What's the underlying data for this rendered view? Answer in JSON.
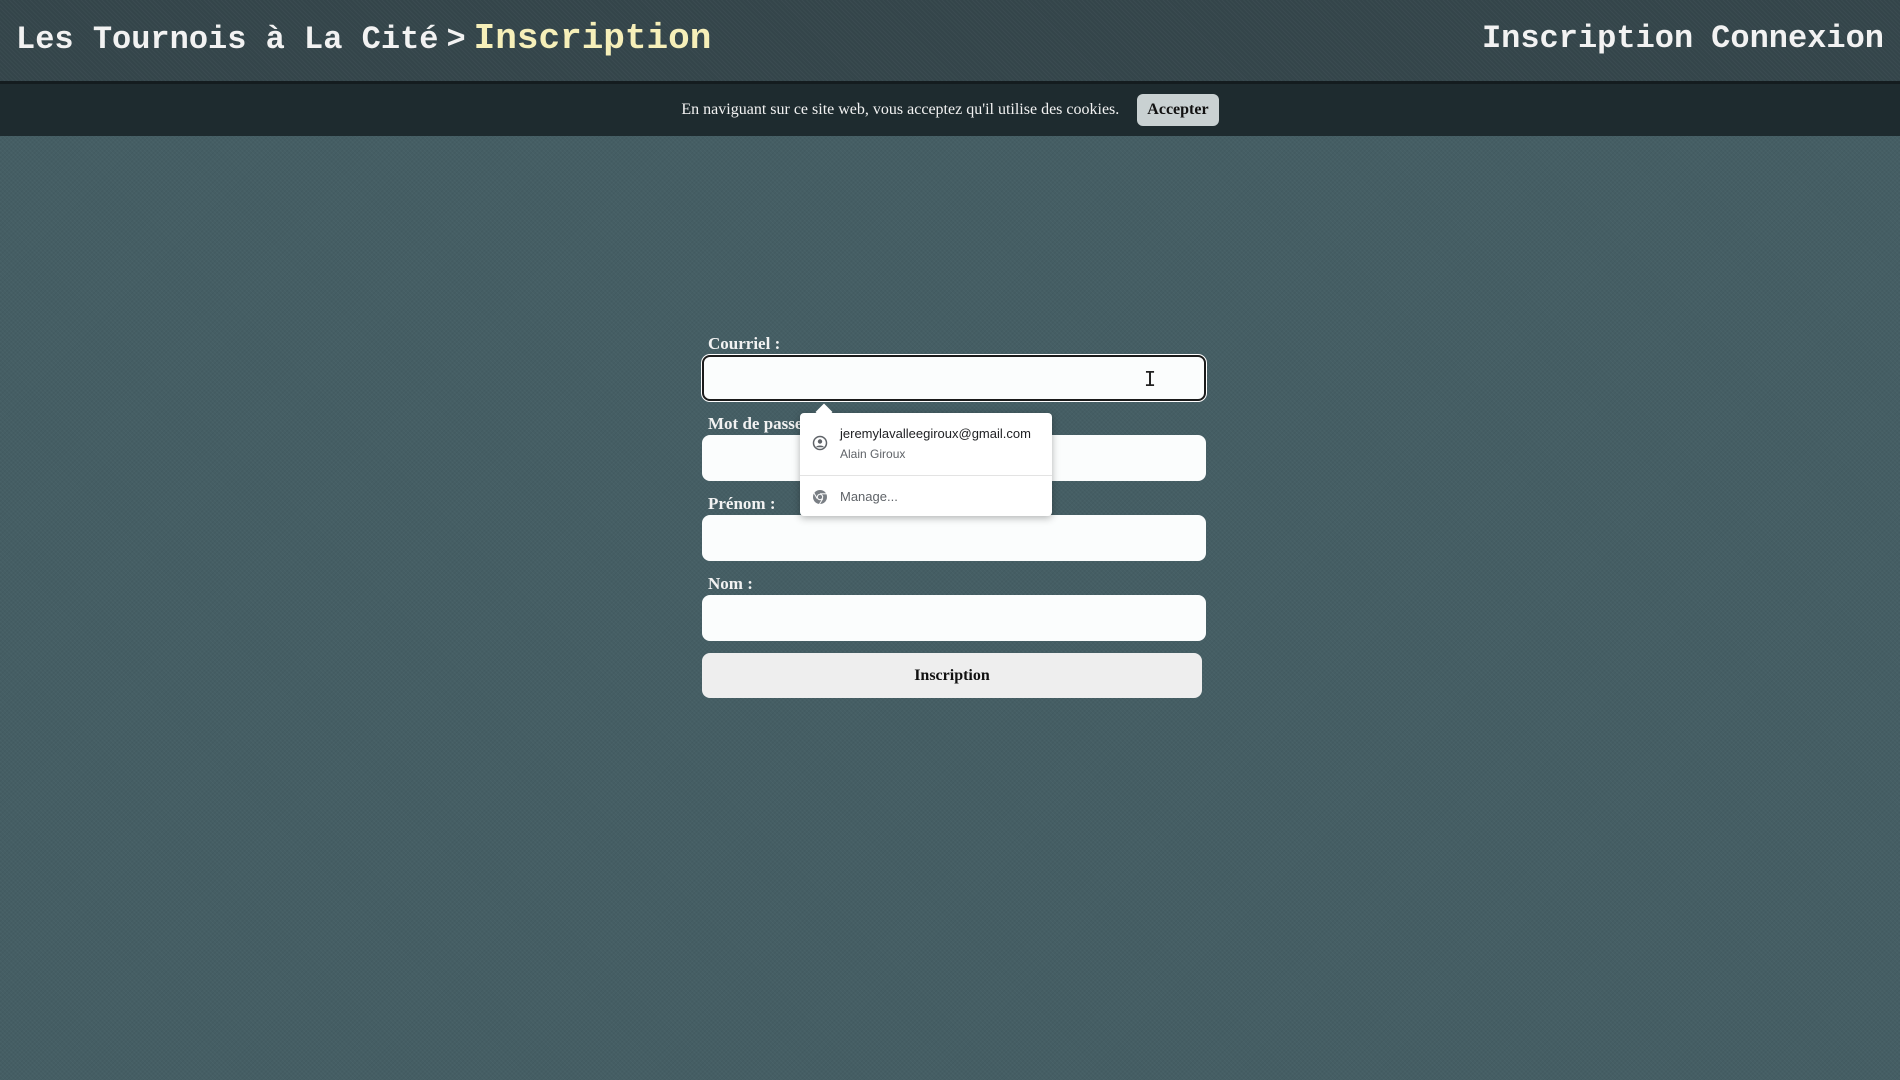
{
  "header": {
    "site_title": "Les Tournois à La Cité",
    "separator": ">",
    "current_page": "Inscription",
    "nav": {
      "inscription": "Inscription",
      "connexion": "Connexion"
    }
  },
  "cookie_bar": {
    "message": "En naviguant sur ce site web, vous acceptez qu'il utilise des cookies.",
    "accept_label": "Accepter"
  },
  "form": {
    "email_label": "Courriel :",
    "email_value": "",
    "password_label": "Mot de passe :",
    "firstname_label": "Prénom :",
    "lastname_label": "Nom :",
    "submit_label": "Inscription"
  },
  "autofill": {
    "suggestion_email": "jeremylavalleegiroux@gmail.com",
    "suggestion_name": "Alain Giroux",
    "manage_label": "Manage...",
    "suggestion_icon": "account-circle-icon",
    "manage_icon": "chrome-icon"
  }
}
